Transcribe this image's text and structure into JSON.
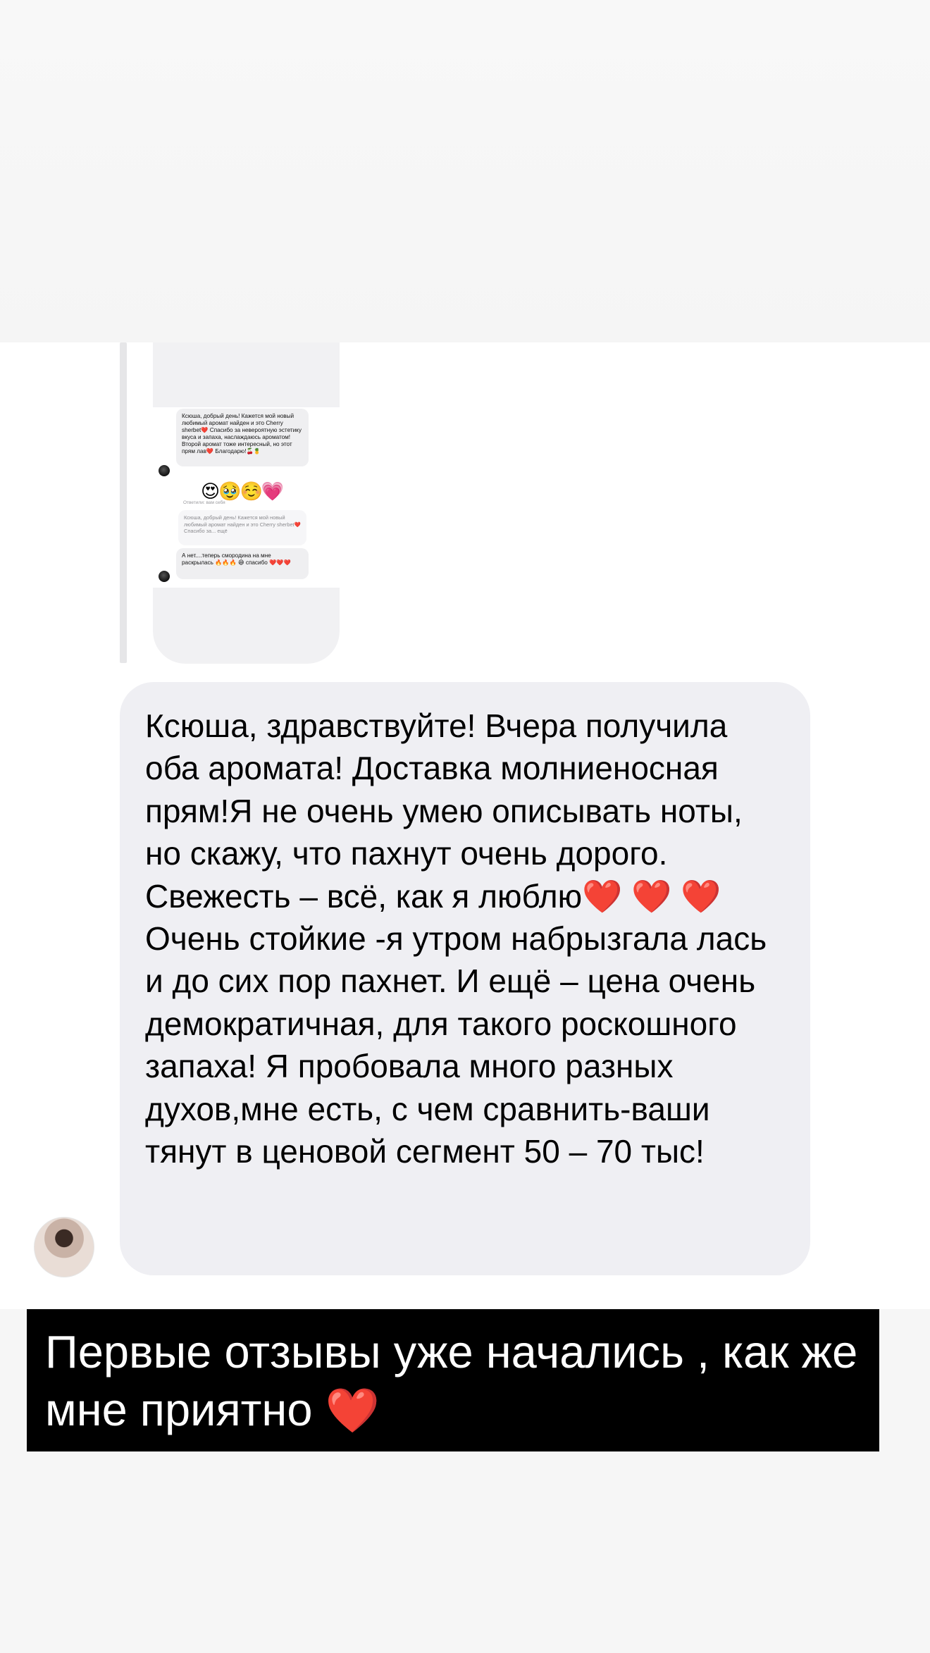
{
  "thumbnail": {
    "message_1": "Ксюша, добрый день! Кажется мой новый любимый аромат найден и это Cherry sherbet❤️ Спасибо за невероятную эстетику вкуса и запаха, наслаждаюсь ароматом! Второй аромат тоже интересный, но этот прям лав❤️ Благодарю!🍒🍍",
    "emoji_reaction": "😍🥹☺️💗",
    "reply_label": "Ответили: вам себя",
    "quoted_message": "Ксюша, добрый день! Кажется мой новый любимый аромат найден и это Cherry sherbet❤️ Спасибо за... ещё",
    "message_2": "А нет....теперь смородина на мне раскрылась 🔥🔥🔥 😅 спасибо ❤️❤️❤️"
  },
  "message": {
    "text_before_hearts": "Ксюша, здравствуйте! Вчера получила оба аромата! Доставка молниеносная прям!Я не очень умею описывать ноты, но скажу, что пахнут очень дорого. Свежесть – всё, как я люблю",
    "hearts": "❤️ ❤️ ❤️",
    "text_after_hearts": "Очень стойкие -я утром набрызгала лась и до сих пор пахнет. И ещё – цена очень демократичная, для такого роскошного запаха! Я пробовала много разных духов,мне есть, с чем сравнить-ваши тянут в ценовой сегмент 50 – 70 тыс!"
  },
  "caption": {
    "text": "Первые отзывы уже начались , как же мне приятно",
    "emoji": "❤️"
  },
  "colors": {
    "bubble": "#efeff3",
    "caption_bg": "#000000",
    "caption_text": "#ffffff"
  }
}
